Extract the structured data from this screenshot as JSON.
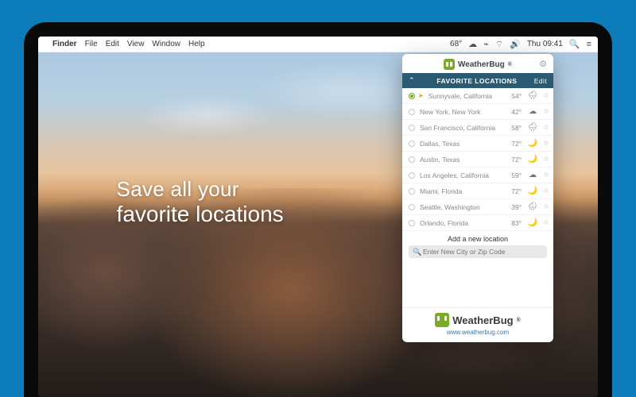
{
  "menubar": {
    "app": "Finder",
    "items": [
      "File",
      "Edit",
      "View",
      "Window",
      "Help"
    ],
    "temp": "68°",
    "clock": "Thu 09:41"
  },
  "hero": {
    "line1": "Save all your",
    "line2": "favorite locations"
  },
  "popover": {
    "brand": "WeatherBug",
    "fav_title": "FAVORITE LOCATIONS",
    "edit": "Edit",
    "add_label": "Add a new location",
    "search_placeholder": "Enter New City or Zip Code",
    "footer_url": "www.weatherbug.com",
    "locations": [
      {
        "name": "Sunnyvale, California",
        "temp": "54°",
        "icon": "🌧",
        "current": true
      },
      {
        "name": "New York, New York",
        "temp": "42°",
        "icon": "☁",
        "current": false
      },
      {
        "name": "San Francisco, California",
        "temp": "58°",
        "icon": "🌧",
        "current": false
      },
      {
        "name": "Dallas, Texas",
        "temp": "72°",
        "icon": "🌙",
        "current": false
      },
      {
        "name": "Austin, Texas",
        "temp": "72°",
        "icon": "🌙",
        "current": false
      },
      {
        "name": "Los Angeles, California",
        "temp": "59°",
        "icon": "☁",
        "current": false
      },
      {
        "name": "Miami, Florida",
        "temp": "72°",
        "icon": "🌙",
        "current": false
      },
      {
        "name": "Seattle, Washington",
        "temp": "39°",
        "icon": "🌧",
        "current": false
      },
      {
        "name": "Orlando, Florida",
        "temp": "83°",
        "icon": "🌙",
        "current": false
      }
    ]
  }
}
